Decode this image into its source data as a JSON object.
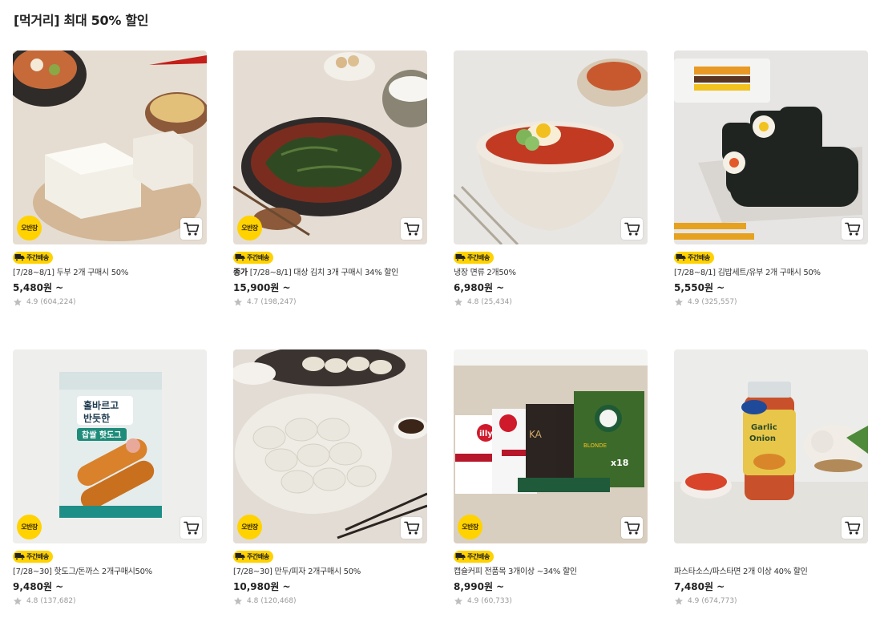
{
  "section": {
    "title": "[먹거리] 최대 50% 할인"
  },
  "labels": {
    "obanjang": "오반장",
    "weekly_delivery": "주간배송"
  },
  "colors": {
    "badge_yellow": "#ffd200",
    "text": "#222222",
    "muted": "#9a9a9a"
  },
  "products": [
    {
      "brand": "",
      "name": "[7/28~8/1] 두부 2개 구매시 50%",
      "price": "5,480원 ~",
      "rating": "4.9",
      "reviews": "(604,224)",
      "obanjang": true,
      "weekly": true,
      "image": "tofu"
    },
    {
      "brand": "종가",
      "name": " [7/28~8/1] 대상 김치 3개 구매시 34% 할인",
      "price": "15,900원 ~",
      "rating": "4.7",
      "reviews": "(198,247)",
      "obanjang": true,
      "weekly": true,
      "image": "kimchi"
    },
    {
      "brand": "",
      "name": "냉장 면류 2개50%",
      "price": "6,980원 ~",
      "rating": "4.8",
      "reviews": "(25,434)",
      "obanjang": false,
      "weekly": true,
      "image": "noodles"
    },
    {
      "brand": "",
      "name": "[7/28~8/1] 김밥세트/유부 2개 구매시 50%",
      "price": "5,550원 ~",
      "rating": "4.9",
      "reviews": "(325,557)",
      "obanjang": false,
      "weekly": true,
      "image": "kimbap"
    },
    {
      "brand": "",
      "name": "[7/28~30] 핫도그/돈까스 2개구매시50%",
      "price": "9,480원 ~",
      "rating": "4.8",
      "reviews": "(137,682)",
      "obanjang": true,
      "weekly": true,
      "image": "hotdog"
    },
    {
      "brand": "",
      "name": "[7/28~30] 만두/피자 2개구매시 50%",
      "price": "10,980원 ~",
      "rating": "4.8",
      "reviews": "(120,468)",
      "obanjang": true,
      "weekly": true,
      "image": "dumpling"
    },
    {
      "brand": "",
      "name": "캡슐커피 전품목 3개이상 ~34% 할인",
      "price": "8,990원 ~",
      "rating": "4.9",
      "reviews": "(60,733)",
      "obanjang": true,
      "weekly": true,
      "image": "coffee"
    },
    {
      "brand": "",
      "name": "파스타소스/파스타면 2개 이상 40% 할인",
      "price": "7,480원 ~",
      "rating": "4.9",
      "reviews": "(674,773)",
      "obanjang": false,
      "weekly": false,
      "image": "pasta"
    }
  ]
}
